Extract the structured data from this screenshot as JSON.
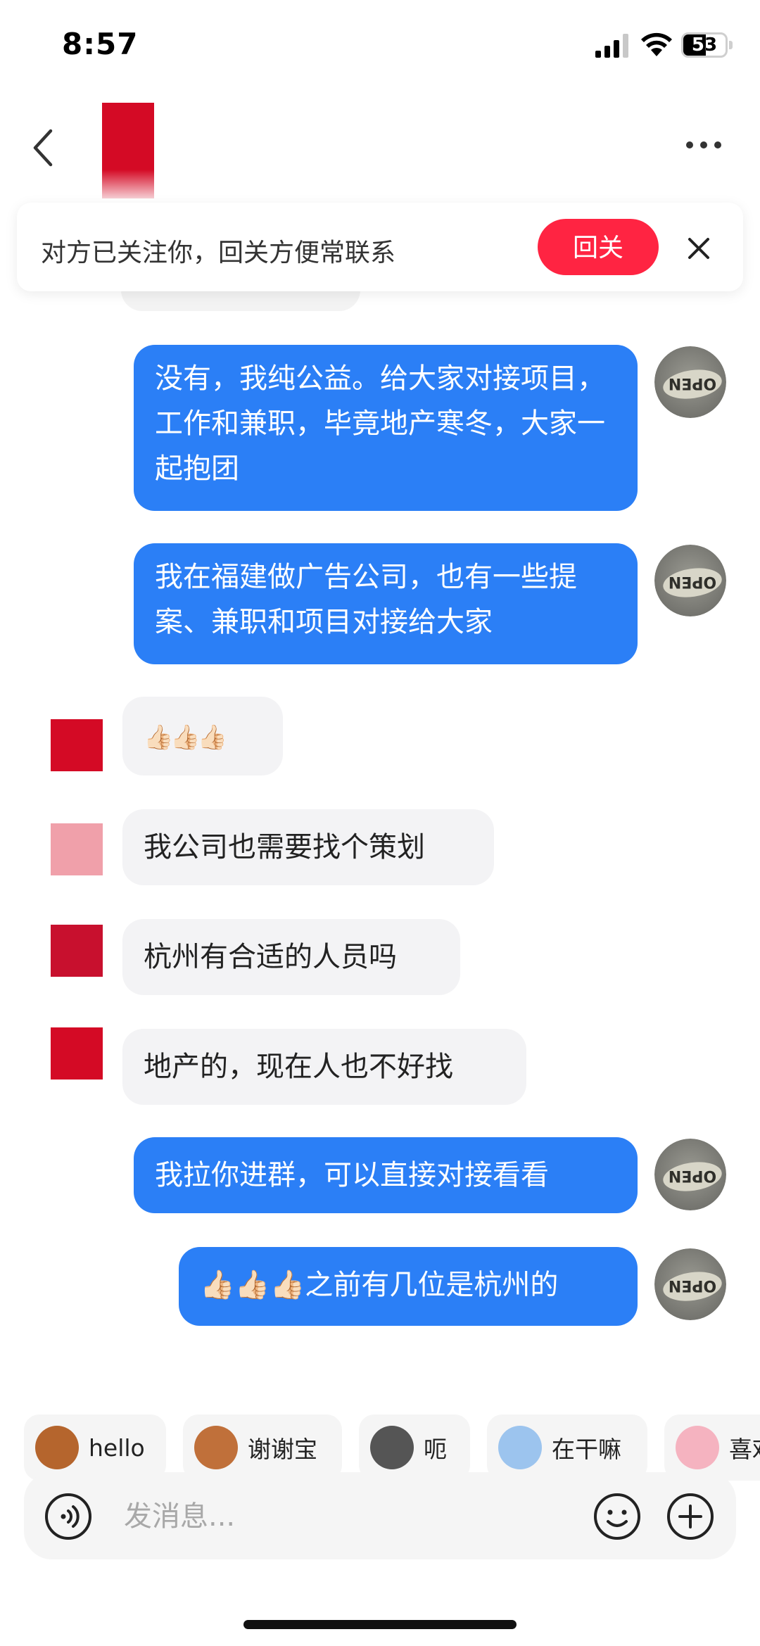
{
  "status_bar": {
    "time": "8:57",
    "battery": "53"
  },
  "banner": {
    "text": "对方已关注你，回关方便常联系",
    "follow_label": "回关"
  },
  "messages": [
    {
      "from": "me",
      "text": "没有，我纯公益。给大家对接项目，工作和兼职，毕竟地产寒冬，大家一起抱团"
    },
    {
      "from": "me",
      "text": "我在福建做广告公司，也有一些提案、兼职和项目对接给大家"
    },
    {
      "from": "them",
      "text": "👍🏻👍🏻👍🏻"
    },
    {
      "from": "them",
      "text": "我公司也需要找个策划"
    },
    {
      "from": "them",
      "text": "杭州有合适的人员吗"
    },
    {
      "from": "them",
      "text": "地产的，现在人也不好找"
    },
    {
      "from": "me",
      "text": "我拉你进群，可以直接对接看看"
    },
    {
      "from": "me",
      "text": "👍🏻👍🏻👍🏻之前有几位是杭州的"
    }
  ],
  "avatar_text": "OPEN",
  "quick_replies": [
    {
      "label": "hello",
      "icon": "monkey-icon"
    },
    {
      "label": "谢谢宝",
      "icon": "monkey-flower-icon"
    },
    {
      "label": "呃",
      "icon": "cat-icon"
    },
    {
      "label": "在干嘛",
      "icon": "magnifier-girl-icon"
    },
    {
      "label": "喜欢",
      "icon": "pig-icon"
    }
  ],
  "input": {
    "placeholder": "发消息..."
  },
  "colors": {
    "accent_blue": "#2b7ff6",
    "follow_red": "#ff2442",
    "profile_red": "#d40a25"
  }
}
